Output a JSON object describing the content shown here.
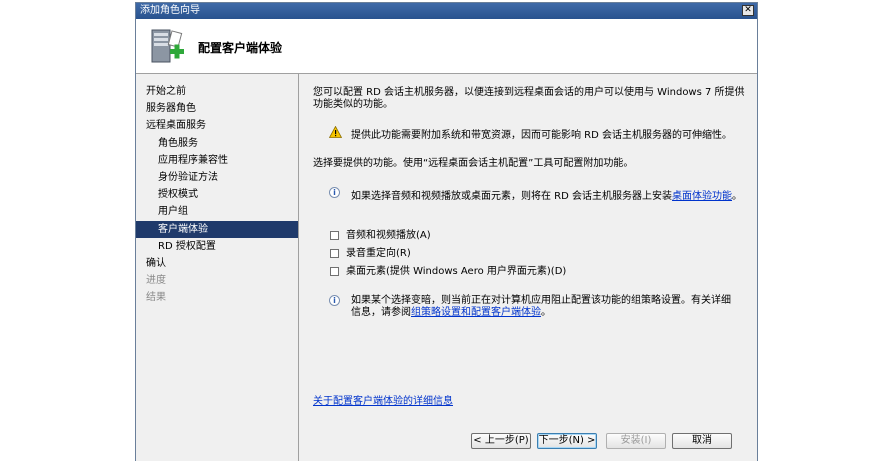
{
  "window": {
    "title": "添加角色向导",
    "close_glyph": "✕"
  },
  "header": {
    "title": "配置客户端体验",
    "icon": "server-add-icon"
  },
  "sidebar": {
    "items": [
      {
        "label": "开始之前",
        "level": 0,
        "state": "normal"
      },
      {
        "label": "服务器角色",
        "level": 0,
        "state": "normal"
      },
      {
        "label": "远程桌面服务",
        "level": 0,
        "state": "normal"
      },
      {
        "label": "角色服务",
        "level": 1,
        "state": "normal"
      },
      {
        "label": "应用程序兼容性",
        "level": 1,
        "state": "normal"
      },
      {
        "label": "身份验证方法",
        "level": 1,
        "state": "normal"
      },
      {
        "label": "授权模式",
        "level": 1,
        "state": "normal"
      },
      {
        "label": "用户组",
        "level": 1,
        "state": "normal"
      },
      {
        "label": "客户端体验",
        "level": 1,
        "state": "active"
      },
      {
        "label": "RD 授权配置",
        "level": 1,
        "state": "normal"
      },
      {
        "label": "确认",
        "level": 0,
        "state": "normal"
      },
      {
        "label": "进度",
        "level": 0,
        "state": "disabled"
      },
      {
        "label": "结果",
        "level": 0,
        "state": "disabled"
      }
    ]
  },
  "content": {
    "intro": "您可以配置 RD 会话主机服务器，以便连接到远程桌面会话的用户可以使用与 Windows 7 所提供功能类似的功能。",
    "warning": "提供此功能需要附加系统和带宽资源，因而可能影响 RD 会话主机服务器的可伸缩性。",
    "select_text": "选择要提供的功能。使用“远程桌面会话主机配置”工具可配置附加功能。",
    "info1_prefix": "如果选择音频和视频播放或桌面元素，则将在 RD 会话主机服务器上安装",
    "info1_link": "桌面体验功能",
    "info1_suffix": "。",
    "checkboxes": [
      {
        "label": "音频和视频播放(A)",
        "checked": false
      },
      {
        "label": "录音重定向(R)",
        "checked": false
      },
      {
        "label": "桌面元素(提供 Windows Aero 用户界面元素)(D)",
        "checked": false
      }
    ],
    "info2_prefix": "如果某个选择变暗，则当前正在对计算机应用阻止配置该功能的组策略设置。有关详细信息，请参阅",
    "info2_link": "组策略设置和配置客户端体验",
    "info2_suffix": "。",
    "more_link": "关于配置客户端体验的详细信息"
  },
  "footer": {
    "back": "< 上一步(P)",
    "next": "下一步(N) >",
    "install": "安装(I)",
    "cancel": "取消"
  },
  "colors": {
    "title_bar": "#28528e",
    "active_nav": "#1f3a6b",
    "link": "#0033cc"
  }
}
